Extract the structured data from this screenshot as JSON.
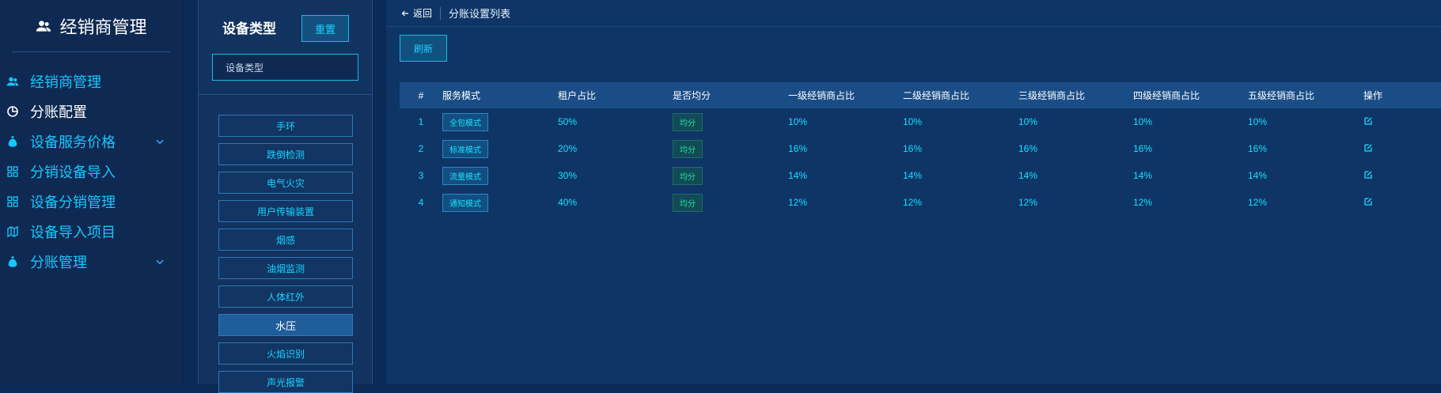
{
  "sidebar": {
    "brand": "经销商管理",
    "items": [
      {
        "label": "经销商管理",
        "icon": "users-icon"
      },
      {
        "label": "分账配置",
        "icon": "pie-chart-icon",
        "active": true
      },
      {
        "label": "设备服务价格",
        "icon": "money-bag-icon",
        "expandable": true
      },
      {
        "label": "分销设备导入",
        "icon": "grid-icon"
      },
      {
        "label": "设备分销管理",
        "icon": "grid-icon"
      },
      {
        "label": "设备导入项目",
        "icon": "map-icon"
      },
      {
        "label": "分账管理",
        "icon": "money-bag-icon",
        "expandable": true
      }
    ]
  },
  "device_panel": {
    "title": "设备类型",
    "reset_label": "重置",
    "input_value": "设备类型",
    "items": [
      "手环",
      "跌倒检测",
      "电气火灾",
      "用户传输装置",
      "烟感",
      "油烟监测",
      "人体红外",
      "水压",
      "火焰识别",
      "声光报警"
    ],
    "selected": "水压"
  },
  "topbar": {
    "back_label": "返回",
    "title": "分账设置列表"
  },
  "refresh_label": "刷新",
  "table": {
    "headers": [
      "#",
      "服务模式",
      "租户占比",
      "是否均分",
      "一级经销商占比",
      "二级经销商占比",
      "三级经销商占比",
      "四级经销商占比",
      "五级经销商占比",
      "操作"
    ],
    "rows": [
      {
        "no": "1",
        "mode": "全包模式",
        "tenant": "50%",
        "avg": "均分",
        "l1": "10%",
        "l2": "10%",
        "l3": "10%",
        "l4": "10%",
        "l5": "10%"
      },
      {
        "no": "2",
        "mode": "标准模式",
        "tenant": "20%",
        "avg": "均分",
        "l1": "16%",
        "l2": "16%",
        "l3": "16%",
        "l4": "16%",
        "l5": "16%"
      },
      {
        "no": "3",
        "mode": "流量模式",
        "tenant": "30%",
        "avg": "均分",
        "l1": "14%",
        "l2": "14%",
        "l3": "14%",
        "l4": "14%",
        "l5": "14%"
      },
      {
        "no": "4",
        "mode": "通知模式",
        "tenant": "40%",
        "avg": "均分",
        "l1": "12%",
        "l2": "12%",
        "l3": "12%",
        "l4": "12%",
        "l5": "12%"
      }
    ]
  },
  "colors": {
    "accent": "#19c5ff",
    "background": "#0e3566",
    "sidebar": "#0f2a52"
  }
}
